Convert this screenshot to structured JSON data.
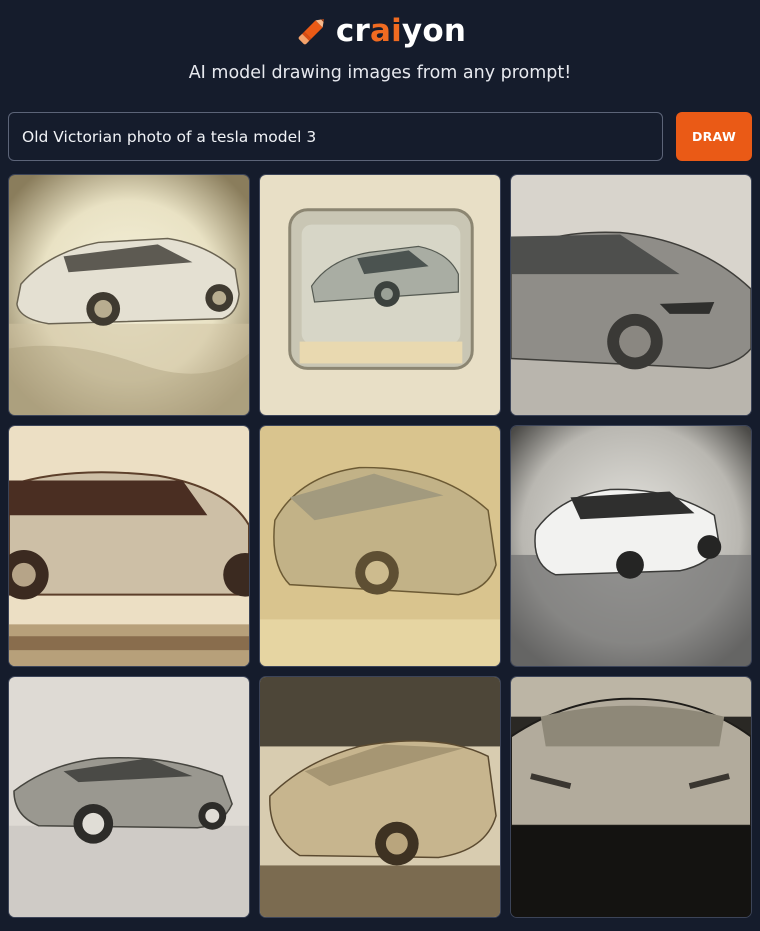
{
  "header": {
    "logo_prefix": "cr",
    "logo_accent": "ai",
    "logo_suffix": "yon",
    "logo_icon": "pencil-icon",
    "tagline": "AI model drawing images from any prompt!"
  },
  "prompt": {
    "value": "Old Victorian photo of a tesla model 3",
    "button_label": "DRAW"
  },
  "colors": {
    "background": "#151c2c",
    "accent": "#ea5a16",
    "text": "#ffffff"
  },
  "results": [
    {
      "label": "generated-image-1"
    },
    {
      "label": "generated-image-2"
    },
    {
      "label": "generated-image-3"
    },
    {
      "label": "generated-image-4"
    },
    {
      "label": "generated-image-5"
    },
    {
      "label": "generated-image-6"
    },
    {
      "label": "generated-image-7"
    },
    {
      "label": "generated-image-8"
    },
    {
      "label": "generated-image-9"
    }
  ]
}
